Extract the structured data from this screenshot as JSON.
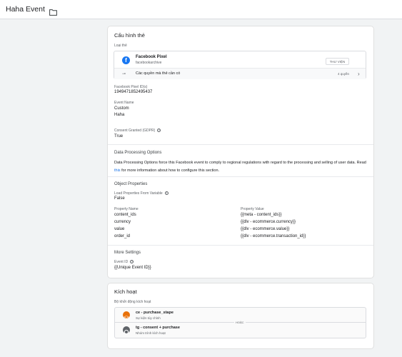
{
  "header": {
    "title": "Haha Event",
    "folder_icon": "folder-icon"
  },
  "tag_config": {
    "title": "Cấu hình thẻ",
    "tag_type_label": "Loại thẻ",
    "tag": {
      "name": "Facebook Pixel",
      "sub": "facebookarchive",
      "icon": "facebook-icon",
      "library_button": "THƯ VIỆN"
    },
    "permissions": {
      "label": "Các quyền mà thẻ cần có",
      "count": "4 quyền"
    },
    "pixel_id_label": "Facebook Pixel ID(s)",
    "pixel_id_value": "1949471852495437",
    "event_name_label": "Event Name",
    "event_name_type": "Custom",
    "event_name_value": "Haha",
    "consent_label": "Consent Granted (GDPR)",
    "consent_value": "True",
    "dpo_title": "Data Processing Options",
    "dpo_text_1": "Data Processing Options force this Facebook event to comply to regional regulations with regard to the processing and selling of user data. Read ",
    "dpo_link": "this",
    "dpo_text_2": " for more information about how to configure this section.",
    "object_props_title": "Object Properties",
    "load_from_var_label": "Load Properties From Variable",
    "load_from_var_value": "False",
    "prop_name_header": "Property Name",
    "prop_value_header": "Property Value",
    "properties": [
      {
        "name": "content_ids",
        "value": "{{meta - content_ids}}"
      },
      {
        "name": "currency",
        "value": "{{dlv - ecommerce.currency}}"
      },
      {
        "name": "value",
        "value": "{{dlv - ecommerce.value}}"
      },
      {
        "name": "order_id",
        "value": "{{dlv - ecommerce.transaction_id}}"
      }
    ],
    "more_settings_title": "More Settings",
    "event_id_label": "Event ID",
    "event_id_value": "{{Unique Event ID}}"
  },
  "triggering": {
    "title": "Kích hoạt",
    "subtitle": "Bộ khởi động kích hoạt",
    "or_label": "HOẶC",
    "triggers": [
      {
        "name": "ce - purchase_stape",
        "type": "Sự kiện tùy chỉnh",
        "color": "#e8710a"
      },
      {
        "name": "tg - consent + purchase",
        "type": "Nhóm trình kích hoạt",
        "color": "#5f6368"
      }
    ]
  }
}
